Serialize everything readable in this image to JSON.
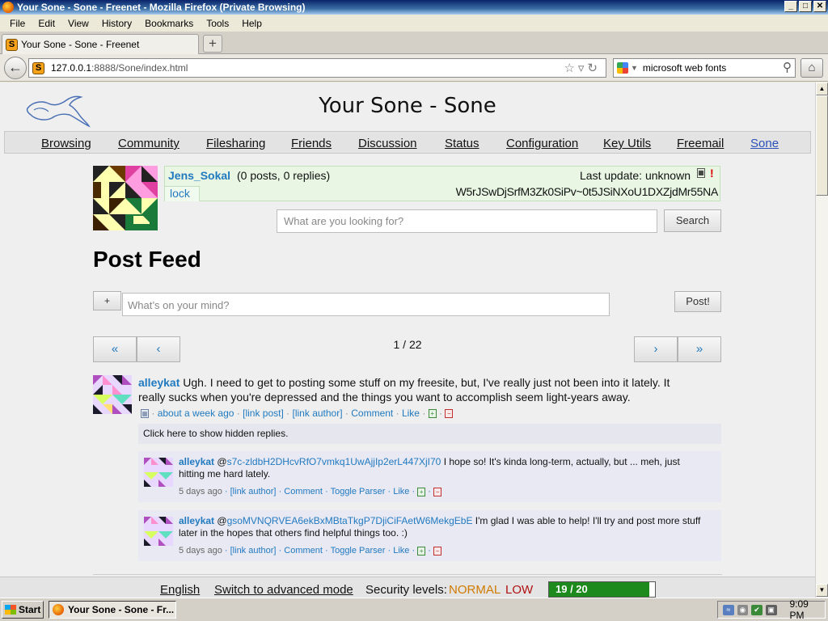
{
  "window": {
    "title": "Your Sone - Sone - Freenet - Mozilla Firefox (Private Browsing)",
    "buttons": {
      "minimize": "_",
      "maximize": "□",
      "close": "✕"
    }
  },
  "menubar": [
    "File",
    "Edit",
    "View",
    "History",
    "Bookmarks",
    "Tools",
    "Help"
  ],
  "tabs": [
    {
      "label": "Your Sone - Sone - Freenet"
    }
  ],
  "new_tab_label": "+",
  "navbar": {
    "url_host": "127.0.0.1",
    "url_rest": ":8888/Sone/index.html",
    "search_value": "microsoft web fonts"
  },
  "page": {
    "title": "Your Sone - Sone",
    "nav": [
      "Browsing",
      "Community",
      "Filesharing",
      "Friends",
      "Discussion",
      "Status",
      "Configuration",
      "Key Utils",
      "Freemail",
      "Sone"
    ],
    "active_nav": "Sone"
  },
  "profile": {
    "name": "Jens_Sokal",
    "counts": "(0 posts, 0 replies)",
    "last_update": "Last update: unknown",
    "lock": "lock",
    "key": "W5rJSwDjSrfM3Zk0SiPv~0t5JSiNXoU1DXZjdMr55NA",
    "alert": "!"
  },
  "search": {
    "placeholder": "What are you looking for?",
    "button": "Search"
  },
  "feed": {
    "title": "Post Feed",
    "add_button": "+",
    "compose_placeholder": "What’s on your mind?",
    "post_button": "Post!",
    "pagination": {
      "first": "«",
      "prev": "‹",
      "next": "›",
      "last": "»",
      "indicator": "1 / 22"
    }
  },
  "posts": [
    {
      "author": "alleykat",
      "text_line1": "Ugh.  I need to get to posting some stuff on my freesite, but, I've really just not been into it lately.  It",
      "text_line2": "really sucks when you're depressed and the things you want to accomplish seem light-years away.",
      "time": "about a week ago",
      "link_post": "[link post]",
      "link_author": "[link author]",
      "comment": "Comment",
      "like": "Like",
      "hidden_replies": "Click here to show hidden replies.",
      "replies": [
        {
          "author": "alleykat",
          "mention": "s7c-zldbH2DHcvRfO7vmkq1UwAjjIp2erL447XjI70",
          "text_line1": "I hope so!  It's kinda long-term, actually, but ... meh, just",
          "text_line2": "hitting me hard lately.",
          "time": "5 days ago",
          "link_author": "[link author]",
          "comment": "Comment",
          "toggle": "Toggle Parser",
          "like": "Like"
        },
        {
          "author": "alleykat",
          "mention": "gsoMVNQRVEA6ekBxMBtaTkgP7DjiCiFAetW6MekgEbE",
          "text_line1": "I'm glad I was able to help!  I'll try and post more stuff",
          "text_line2": "later in the hopes that others find helpful things too. :)",
          "time": "5 days ago",
          "link_author": "[link author]",
          "comment": "Comment",
          "toggle": "Toggle Parser",
          "like": "Like"
        }
      ]
    }
  ],
  "footer": {
    "language": "English",
    "advanced": "Switch to advanced mode",
    "security_label": "Security levels:",
    "level_normal": "NORMAL",
    "level_low": "LOW",
    "peers": "19 / 20",
    "peers_fraction": 0.95
  },
  "taskbar": {
    "start": "Start",
    "task": "Your Sone - Sone - Fr...",
    "clock": "9:09 PM"
  },
  "colors": {
    "link": "#217ac0",
    "active_nav": "#2b51b8",
    "normal": "#d07a00",
    "low": "#b01010",
    "peers_fill": "#1c8a1c"
  }
}
